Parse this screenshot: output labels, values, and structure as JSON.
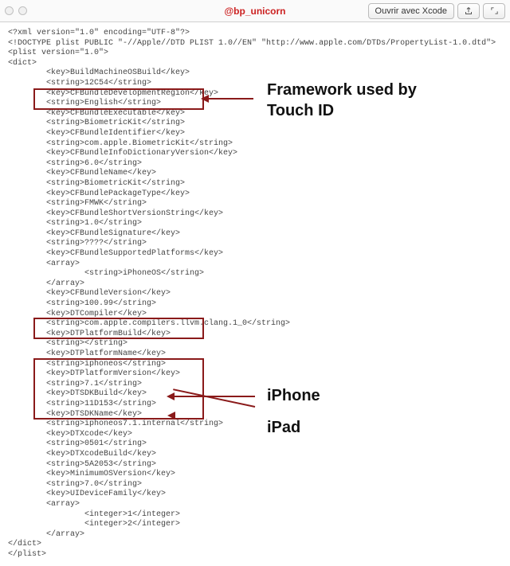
{
  "topbar": {
    "title": "@bp_unicorn",
    "open_button": "Ouvrir avec Xcode",
    "share_icon": "share-icon",
    "fullscreen_icon": "fullscreen-icon"
  },
  "plist": {
    "xml_decl": "<?xml version=\"1.0\" encoding=\"UTF-8\"?>",
    "doctype": "<!DOCTYPE plist PUBLIC \"-//Apple//DTD PLIST 1.0//EN\" \"http://www.apple.com/DTDs/PropertyList-1.0.dtd\">",
    "plist_open": "<plist version=\"1.0\">",
    "dict_open": "<dict>",
    "pairs": [
      {
        "k": "BuildMachineOSBuild",
        "vt": "string",
        "v": "12C54"
      },
      {
        "k": "CFBundleDevelopmentRegion",
        "vt": "string",
        "v": "English"
      },
      {
        "k": "CFBundleExecutable",
        "vt": "string",
        "v": "BiometricKit"
      },
      {
        "k": "CFBundleIdentifier",
        "vt": "string",
        "v": "com.apple.BiometricKit"
      },
      {
        "k": "CFBundleInfoDictionaryVersion",
        "vt": "string",
        "v": "6.0"
      },
      {
        "k": "CFBundleName",
        "vt": "string",
        "v": "BiometricKit"
      },
      {
        "k": "CFBundlePackageType",
        "vt": "string",
        "v": "FMWK"
      },
      {
        "k": "CFBundleShortVersionString",
        "vt": "string",
        "v": "1.0"
      },
      {
        "k": "CFBundleSignature",
        "vt": "string",
        "v": "????"
      },
      {
        "k": "CFBundleSupportedPlatforms",
        "vt": "array",
        "items": [
          "iPhoneOS"
        ]
      },
      {
        "k": "CFBundleVersion",
        "vt": "string",
        "v": "100.99"
      },
      {
        "k": "DTCompiler",
        "vt": "string",
        "v": "com.apple.compilers.llvm.clang.1_0"
      },
      {
        "k": "DTPlatformBuild",
        "vt": "string",
        "v": ""
      },
      {
        "k": "DTPlatformName",
        "vt": "string",
        "v": "iphoneos"
      },
      {
        "k": "DTPlatformVersion",
        "vt": "string",
        "v": "7.1"
      },
      {
        "k": "DTSDKBuild",
        "vt": "string",
        "v": "11D153"
      },
      {
        "k": "DTSDKName",
        "vt": "string",
        "v": "iphoneos7.1.internal"
      },
      {
        "k": "DTXcode",
        "vt": "string",
        "v": "0501"
      },
      {
        "k": "DTXcodeBuild",
        "vt": "string",
        "v": "5A2053"
      },
      {
        "k": "MinimumOSVersion",
        "vt": "string",
        "v": "7.0"
      },
      {
        "k": "UIDeviceFamily",
        "vt": "int-array",
        "items": [
          "1",
          "2"
        ]
      }
    ],
    "dict_close": "</dict>",
    "plist_close": "</plist>"
  },
  "annotations": {
    "a1": "Framework used by",
    "a1b": "Touch ID",
    "a2": "iPhone",
    "a3": "iPad"
  }
}
